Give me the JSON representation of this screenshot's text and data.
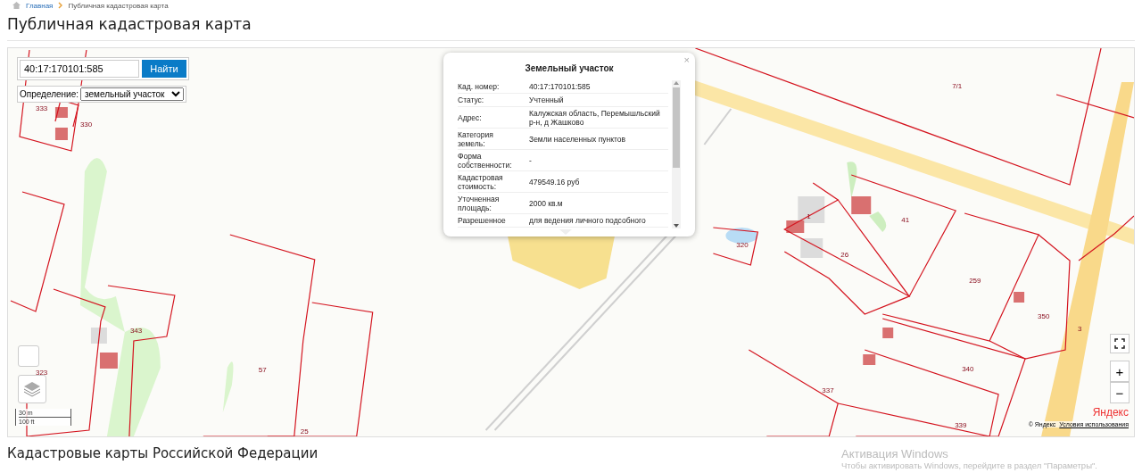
{
  "breadcrumbs": [
    {
      "label": "Главная",
      "kind": "link"
    },
    {
      "label": "Публичная кадастровая карта",
      "kind": "current"
    }
  ],
  "page_title": "Публичная кадастровая карта",
  "search": {
    "value": "40:17:170101:585",
    "button": "Найти"
  },
  "definition": {
    "label": "Определение:",
    "value": "земельный участок"
  },
  "popup": {
    "title": "Земельный участок",
    "close": "×",
    "rows": [
      {
        "label": "Кад. номер:",
        "value": "40:17:170101:585"
      },
      {
        "label": "Статус:",
        "value": "Учтенный"
      },
      {
        "label": "Адрес:",
        "value": "Калужская область, Перемышльский р-н, д Жашково"
      },
      {
        "label": "Категория земель:",
        "value": "Земли населенных пунктов"
      },
      {
        "label": "Форма собственности:",
        "value": "-"
      },
      {
        "label": "Кадастровая стоимость:",
        "value": "479549.16 руб"
      },
      {
        "label": "Уточненная площадь:",
        "value": "2000 кв.м"
      },
      {
        "label": "Разрешенное",
        "value": "для ведения личного подсобного"
      }
    ]
  },
  "map_labels": [
    "333",
    "330",
    "7/1",
    "320",
    "26",
    "41",
    "259",
    "350",
    "3",
    "343",
    "57",
    "25",
    "337",
    "340",
    "339",
    "1",
    "323"
  ],
  "scale": {
    "metric": "30 m",
    "imperial": "100 ft"
  },
  "zoom": {
    "in": "+",
    "out": "−"
  },
  "attribution": {
    "logo": "Яндекс",
    "copyright": "© Яндекс",
    "terms": "Условия использования"
  },
  "section_title": "Кадастровые карты Российской Федерации",
  "windows_notice": {
    "title": "Активация Windows",
    "text": "Чтобы активировать Windows, перейдите в раздел \"Параметры\"."
  }
}
